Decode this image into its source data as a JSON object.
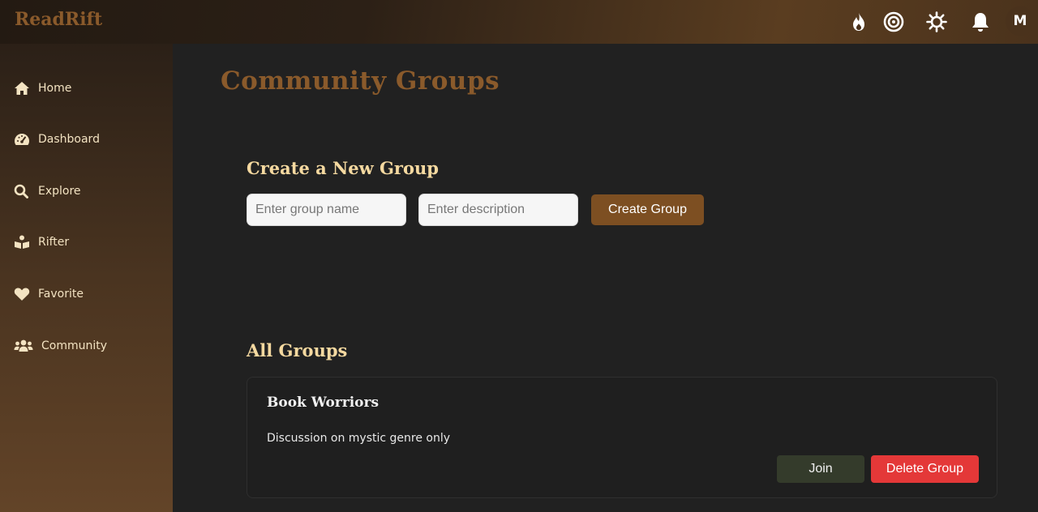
{
  "app": {
    "logo": "ReadRift",
    "avatar_initial": "M"
  },
  "topbar": {
    "icons": [
      "fire-icon",
      "target-icon",
      "sun-icon",
      "bell-icon"
    ]
  },
  "sidebar": {
    "items": [
      {
        "label": "Home",
        "icon": "home-icon"
      },
      {
        "label": "Dashboard",
        "icon": "gauge-icon"
      },
      {
        "label": "Explore",
        "icon": "search-icon"
      },
      {
        "label": "Rifter",
        "icon": "reader-icon"
      },
      {
        "label": "Favorite",
        "icon": "heart-icon"
      },
      {
        "label": "Community",
        "icon": "users-icon"
      }
    ]
  },
  "main": {
    "title": "Community Groups",
    "create": {
      "heading": "Create a New Group",
      "name_placeholder": "Enter group name",
      "name_value": "",
      "desc_placeholder": "Enter description",
      "desc_value": "",
      "button_label": "Create Group"
    },
    "all_groups": {
      "heading": "All Groups",
      "groups": [
        {
          "name": "Book Worriors",
          "description": "Discussion on mystic genre only",
          "join_label": "Join",
          "delete_label": "Delete Group"
        }
      ]
    }
  },
  "colors": {
    "accent": "#8a5a2b",
    "heading": "#f5d9a0",
    "danger": "#e43838",
    "join": "#343b2b",
    "background": "#212121"
  }
}
